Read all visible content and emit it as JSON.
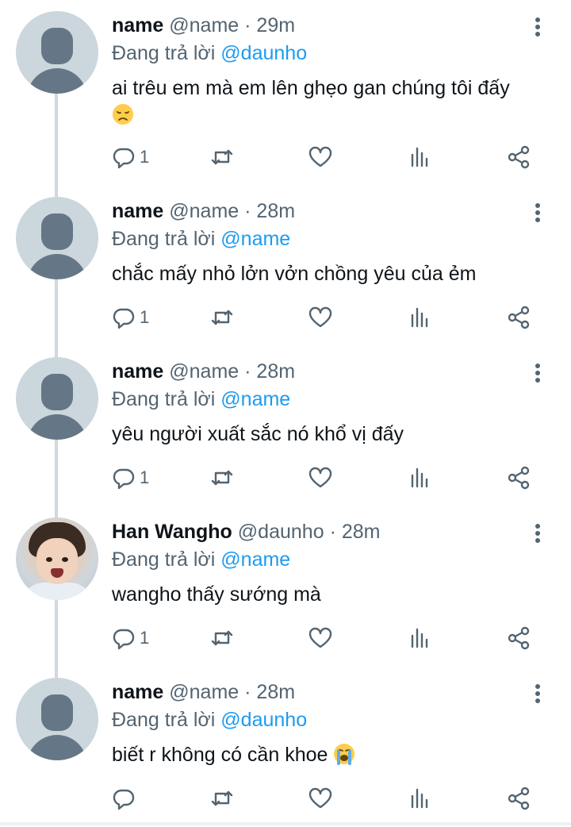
{
  "thread": {
    "reply_prefix": "Đang trả lời",
    "tweets": [
      {
        "display_name": "name",
        "handle": "@name",
        "separator": "·",
        "time": "29m",
        "reply_to": "@daunho",
        "text": "ai trêu em mà em lên ghẹo gan chúng tôi đấy",
        "emoji": "disappointed-face",
        "reply_count": "1",
        "avatar": "default-avatar"
      },
      {
        "display_name": "name",
        "handle": "@name",
        "separator": "·",
        "time": "28m",
        "reply_to": "@name",
        "text": "chắc mấy nhỏ lởn vởn chồng yêu của ẻm",
        "reply_count": "1",
        "avatar": "default-avatar"
      },
      {
        "display_name": "name",
        "handle": "@name",
        "separator": "·",
        "time": "28m",
        "reply_to": "@name",
        "text": "yêu người xuất sắc nó khổ vị đấy",
        "reply_count": "1",
        "avatar": "default-avatar"
      },
      {
        "display_name": "Han Wangho",
        "handle": "@daunho",
        "separator": "·",
        "time": "28m",
        "reply_to": "@name",
        "text": "wangho thấy sướng mà",
        "reply_count": "1",
        "avatar": "photo-avatar"
      },
      {
        "display_name": "name",
        "handle": "@name",
        "separator": "·",
        "time": "28m",
        "reply_to": "@daunho",
        "text": "biết r không có cần khoe",
        "emoji": "loudly-crying-face",
        "reply_count": "",
        "avatar": "default-avatar"
      }
    ]
  },
  "icons": {
    "reply": "reply-icon",
    "retweet": "retweet-icon",
    "like": "heart-icon",
    "views": "views-icon",
    "share": "share-icon",
    "more": "more-icon"
  },
  "colors": {
    "text": "#0f1419",
    "secondary": "#536471",
    "mention": "#1d9bf0",
    "connector": "#cfd9de",
    "avatar_bg": "#ccd6dd",
    "avatar_fg": "#657786"
  }
}
